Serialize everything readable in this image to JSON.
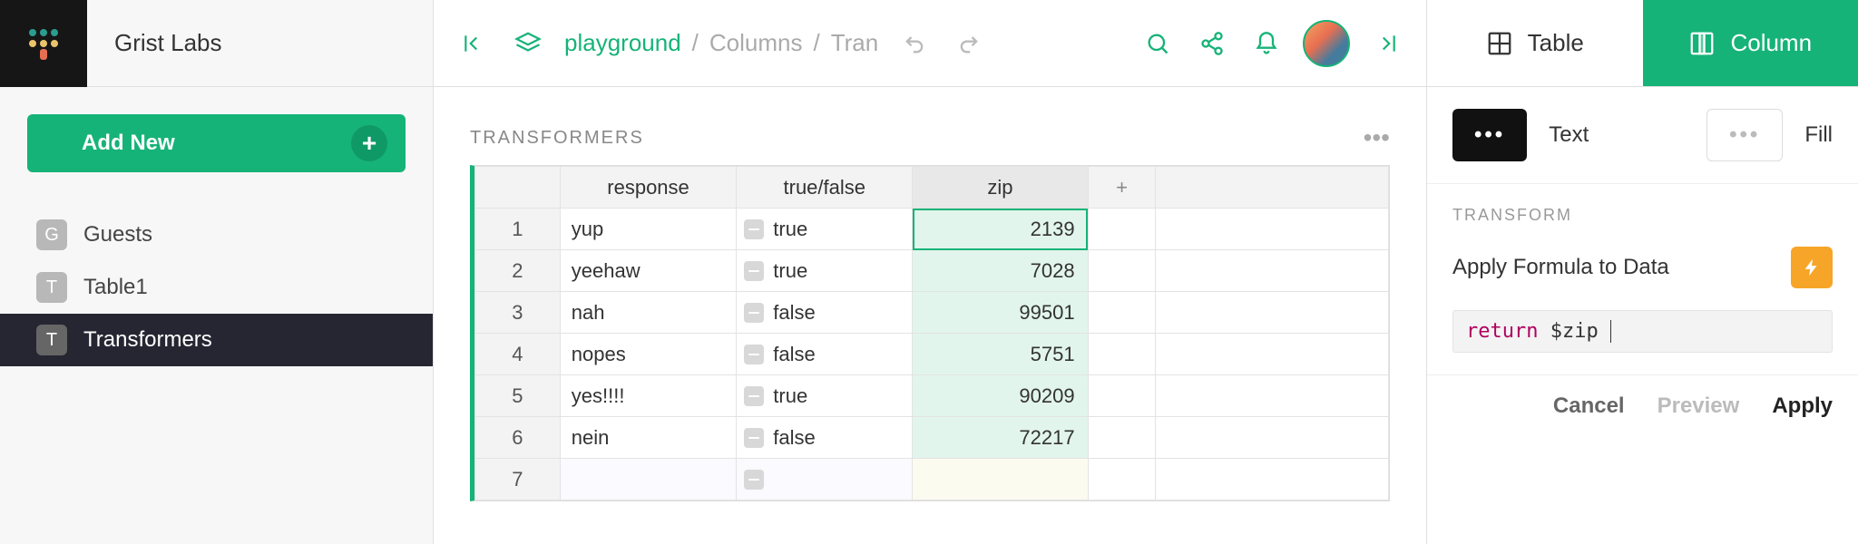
{
  "org": {
    "name": "Grist Labs"
  },
  "sidebar": {
    "add_label": "Add New",
    "items": [
      {
        "badge": "G",
        "label": "Guests"
      },
      {
        "badge": "T",
        "label": "Table1"
      },
      {
        "badge": "T",
        "label": "Transformers"
      }
    ]
  },
  "breadcrumb": {
    "doc": "playground",
    "mid": "Columns",
    "leaf": "Tran"
  },
  "table": {
    "title": "TRANSFORMERS",
    "columns": [
      "response",
      "true/false",
      "zip"
    ],
    "add_col": "+",
    "rows": [
      {
        "n": "1",
        "response": "yup",
        "tf": "true",
        "zip": "2139"
      },
      {
        "n": "2",
        "response": "yeehaw",
        "tf": "true",
        "zip": "7028"
      },
      {
        "n": "3",
        "response": "nah",
        "tf": "false",
        "zip": "99501"
      },
      {
        "n": "4",
        "response": "nopes",
        "tf": "false",
        "zip": "5751"
      },
      {
        "n": "5",
        "response": "yes!!!!",
        "tf": "true",
        "zip": "90209"
      },
      {
        "n": "6",
        "response": "nein",
        "tf": "false",
        "zip": "72217"
      }
    ],
    "new_row_n": "7"
  },
  "rightpanel": {
    "tab_table": "Table",
    "tab_column": "Column",
    "chip_text": "Text",
    "chip_fill": "Fill",
    "section_title": "TRANSFORM",
    "apply_label": "Apply Formula to Data",
    "formula_kw": "return",
    "formula_rest": " $zip",
    "actions": {
      "cancel": "Cancel",
      "preview": "Preview",
      "apply": "Apply"
    }
  }
}
